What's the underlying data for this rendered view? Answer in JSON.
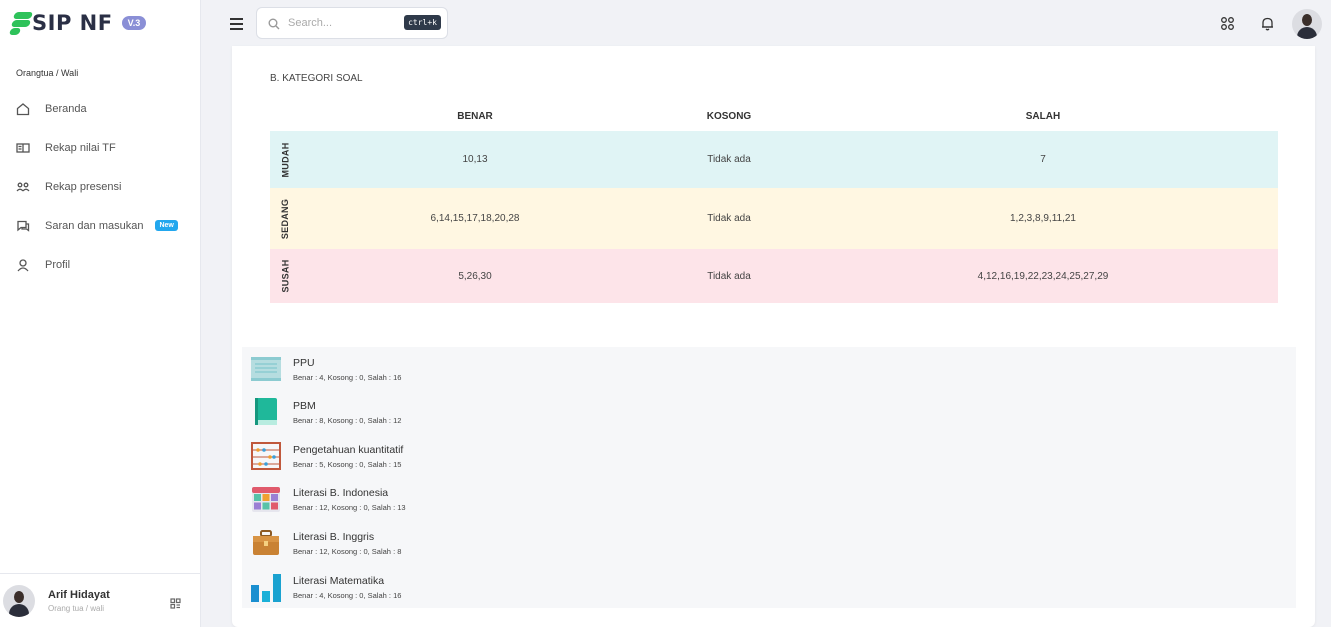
{
  "app": {
    "name": "SIP NF",
    "version": "V.3"
  },
  "sidebar": {
    "section_label": "Orangtua / Wali",
    "items": [
      {
        "label": "Beranda",
        "icon": "home-icon"
      },
      {
        "label": "Rekap nilai TF",
        "icon": "book-open-icon"
      },
      {
        "label": "Rekap presensi",
        "icon": "users-icon"
      },
      {
        "label": "Saran dan masukan",
        "icon": "chat-icon",
        "badge": "New"
      },
      {
        "label": "Profil",
        "icon": "user-icon"
      }
    ],
    "user": {
      "name": "Arif Hidayat",
      "role": "Orang tua / wali"
    }
  },
  "header": {
    "search_placeholder": "Search...",
    "search_shortcut": "ctrl+k"
  },
  "category": {
    "title": "B. KATEGORI SOAL",
    "columns": [
      "BENAR",
      "KOSONG",
      "SALAH"
    ],
    "rows": [
      {
        "level": "MUDAH",
        "benar": "10,13",
        "kosong": "Tidak ada",
        "salah": "7",
        "color": "#e0f4f5"
      },
      {
        "level": "SEDANG",
        "benar": "6,14,15,17,18,20,28",
        "kosong": "Tidak ada",
        "salah": "1,2,3,8,9,11,21",
        "color": "#fff7e2"
      },
      {
        "level": "SUSAH",
        "benar": "5,26,30",
        "kosong": "Tidak ada",
        "salah": "4,12,16,19,22,23,24,25,27,29",
        "color": "#fde4e9"
      }
    ]
  },
  "subjects": [
    {
      "name": "PPU",
      "detail": "Benar : 4, Kosong : 0, Salah : 16",
      "icon": "scroll-icon"
    },
    {
      "name": "PBM",
      "detail": "Benar : 8, Kosong : 0, Salah : 12",
      "icon": "book-icon"
    },
    {
      "name": "Pengetahuan kuantitatif",
      "detail": "Benar : 5, Kosong : 0, Salah : 15",
      "icon": "abacus-icon"
    },
    {
      "name": "Literasi B. Indonesia",
      "detail": "Benar : 12, Kosong : 0, Salah : 13",
      "icon": "calendar-icon"
    },
    {
      "name": "Literasi B. Inggris",
      "detail": "Benar : 12, Kosong : 0, Salah : 8",
      "icon": "suitcase-icon"
    },
    {
      "name": "Literasi Matematika",
      "detail": "Benar : 4, Kosong : 0, Salah : 16",
      "icon": "bar-chart-icon"
    }
  ]
}
